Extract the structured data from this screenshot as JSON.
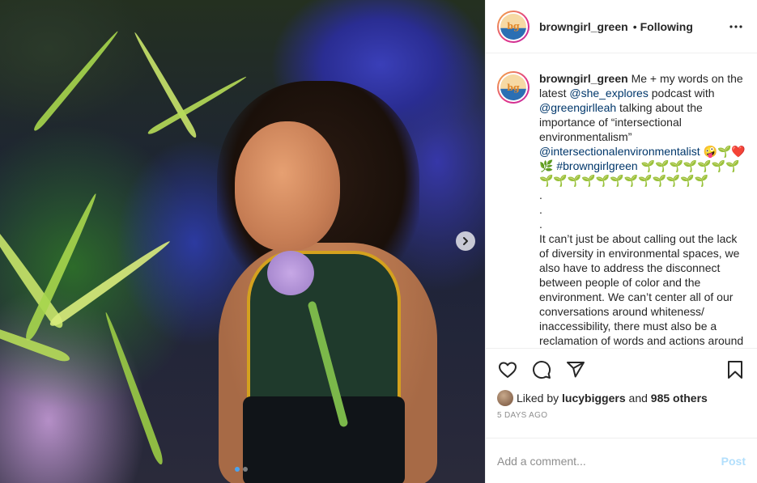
{
  "post": {
    "author": {
      "username": "browngirl_green",
      "follow_status": "Following",
      "avatar_text": "bg"
    },
    "header_separator": "•",
    "more_icon": "more-horizontal-icon",
    "carousel": {
      "next_icon": "chevron-right-icon",
      "slide_count": 2,
      "active_slide": 1
    },
    "caption": {
      "username": "browngirl_green",
      "segments": [
        {
          "type": "text",
          "value": " Me + my words on the latest "
        },
        {
          "type": "mention",
          "value": "@she_explores"
        },
        {
          "type": "text",
          "value": " podcast with "
        },
        {
          "type": "mention",
          "value": "@greengirlleah"
        },
        {
          "type": "text",
          "value": " talking about the importance of “intersectional environmentalism” "
        },
        {
          "type": "mention",
          "value": "@intersectionalenvironmentalist"
        },
        {
          "type": "text",
          "value": " 🤪🌱❤️ 🌿 "
        },
        {
          "type": "mention",
          "value": "#browngirlgreen"
        },
        {
          "type": "text",
          "value": " 🌱🌱🌱🌱🌱🌱🌱🌱🌱🌱🌱🌱🌱🌱🌱🌱🌱🌱🌱"
        }
      ],
      "dot_lines": [
        ".",
        ".",
        "."
      ],
      "body": "It can’t just be about calling out the lack of diversity in environmental spaces, we also have to address the disconnect between people of color and the environment. We can’t center all of our conversations around whiteness/ inaccessibility, there must also be a reclamation of words and actions around environmental"
    },
    "actions": {
      "like_icon": "heart-icon",
      "comment_icon": "comment-icon",
      "share_icon": "send-icon",
      "save_icon": "bookmark-icon"
    },
    "likes": {
      "prefix": "Liked by ",
      "user": "lucybiggers",
      "middle": " and ",
      "others": "985 others"
    },
    "timestamp": "5 days ago",
    "comment": {
      "placeholder": "Add a comment...",
      "post_label": "Post"
    }
  }
}
